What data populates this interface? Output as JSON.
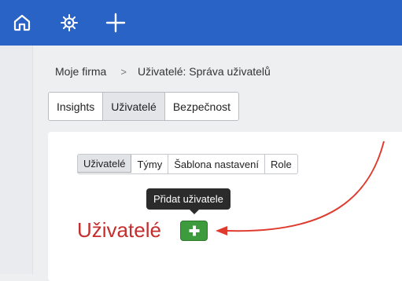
{
  "topbar": {
    "icons": [
      "home-icon",
      "helm-icon",
      "plus-icon"
    ],
    "background": "#2a63c6"
  },
  "breadcrumb": {
    "root": "Moje firma",
    "separator": ">",
    "current": "Uživatelé: Správa uživatelů"
  },
  "main_tabs": [
    {
      "label": "Insights",
      "active": false
    },
    {
      "label": "Uživatelé",
      "active": true
    },
    {
      "label": "Bezpečnost",
      "active": false
    }
  ],
  "sub_tabs": [
    {
      "label": "Uživatelé",
      "active": true
    },
    {
      "label": "Týmy",
      "active": false
    },
    {
      "label": "Šablona nastavení",
      "active": false
    },
    {
      "label": "Role",
      "active": false
    }
  ],
  "tooltip": {
    "text": "Přidat uživatele"
  },
  "page": {
    "heading": "Uživatelé",
    "heading_color": "#c62d2d",
    "add_button_icon": "plus-icon",
    "add_button_color": "#3d9a3d"
  },
  "annotation": {
    "color": "#e03a2e"
  }
}
